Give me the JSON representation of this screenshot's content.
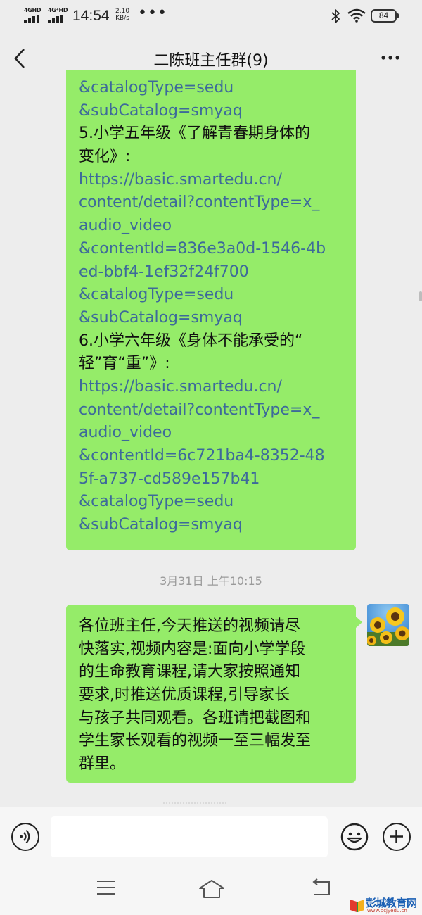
{
  "status_bar": {
    "network_1": "4GHD",
    "network_2": "4G⁺HD",
    "time": "14:54",
    "speed_value": "2.10",
    "speed_unit": "KB/s",
    "more": "•••",
    "battery": "84",
    "icons": [
      "bluetooth-icon",
      "wifi-icon",
      "battery-icon"
    ]
  },
  "nav": {
    "title": "二陈班主任群(9)",
    "back_icon": "chevron-left-icon",
    "more_icon": "more-horizontal-icon"
  },
  "messages": [
    {
      "sender": "self",
      "lines": [
        {
          "text": "&catalogType=sedu",
          "link": true
        },
        {
          "text": "&subCatalog=smyaq",
          "link": true
        },
        {
          "text": "5.小学五年级《了解青春期身体的",
          "link": false
        },
        {
          "text": "变化》:",
          "link": false
        },
        {
          "text": "https://basic.smartedu.cn/",
          "link": true
        },
        {
          "text": "content/detail?contentType=x_",
          "link": true
        },
        {
          "text": "audio_video",
          "link": true
        },
        {
          "text": "&contentId=836e3a0d-1546-4b",
          "link": true
        },
        {
          "text": "ed-bbf4-1ef32f24f700",
          "link": true
        },
        {
          "text": "&catalogType=sedu",
          "link": true
        },
        {
          "text": "&subCatalog=smyaq",
          "link": true
        },
        {
          "text": "6.小学六年级《身体不能承受的“",
          "link": false
        },
        {
          "text": "轻”育“重”》:",
          "link": false
        },
        {
          "text": "https://basic.smartedu.cn/",
          "link": true
        },
        {
          "text": "content/detail?contentType=x_",
          "link": true
        },
        {
          "text": "audio_video",
          "link": true
        },
        {
          "text": "&contentId=6c721ba4-8352-48",
          "link": true
        },
        {
          "text": "5f-a737-cd589e157b41",
          "link": true
        },
        {
          "text": "&catalogType=sedu",
          "link": true
        },
        {
          "text": "&subCatalog=smyaq",
          "link": true
        }
      ]
    },
    {
      "timestamp": "3月31日 上午10:15"
    },
    {
      "sender": "self",
      "lines": [
        {
          "text": "各位班主任,今天推送的视频请尽",
          "link": false
        },
        {
          "text": "快落实,视频内容是:面向小学学段",
          "link": false
        },
        {
          "text": "的生命教育课程,请大家按照通知",
          "link": false
        },
        {
          "text": "要求,时推送优质课程,引导家长",
          "link": false
        },
        {
          "text": "与孩子共同观看。各班请把截图和",
          "link": false
        },
        {
          "text": "学生家长观看的视频一至三幅发至",
          "link": false
        },
        {
          "text": "群里。",
          "link": false
        }
      ]
    }
  ],
  "colors": {
    "bubble": "#95ec69",
    "link": "#3d6a9a",
    "background": "#ededed",
    "timestamp": "#9a9a9a"
  },
  "input_bar": {
    "voice_icon": "voice-icon",
    "input_value": "",
    "emoji_icon": "emoji-icon",
    "plus_icon": "plus-icon"
  },
  "system_nav": {
    "icons": [
      "menu-icon",
      "home-icon",
      "back-icon"
    ]
  },
  "watermark": {
    "name": "彭城教育网",
    "url": "www.pcjyedu.cn"
  }
}
